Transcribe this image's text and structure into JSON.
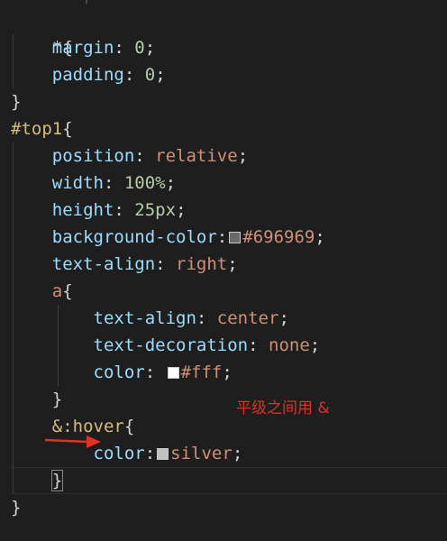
{
  "code": {
    "l1_sel": "*{",
    "l2_prop": "margin",
    "l2_val": "0",
    "l3_prop": "padding",
    "l3_val": "0",
    "l4_close": "}",
    "l5_sel": "#top1",
    "l5_brace": "{",
    "l6_prop": "position",
    "l6_val": "relative",
    "l7_prop": "width",
    "l7_val": "100%",
    "l8_prop": "height",
    "l8_val": "25px",
    "l9_prop": "background-color",
    "l9_val": "#696969",
    "l10_prop": "text-align",
    "l10_val": "right",
    "l11_sel": "a",
    "l11_brace": "{",
    "l12_prop": "text-align",
    "l12_val": "center",
    "l13_prop": "text-decoration",
    "l13_val": "none",
    "l14_prop": "color",
    "l14_val": "#fff",
    "l15_close": "}",
    "l16_sel": "&:hover",
    "l16_brace": "{",
    "l17_prop": "color",
    "l17_val": "silver",
    "l18_close": "}",
    "l19_close": "}"
  },
  "swatches": {
    "gray": "#696969",
    "white": "#ffffff",
    "silver": "#c0c0c0"
  },
  "annotation": {
    "text": "平级之间用 &",
    "color": "#e0302a"
  },
  "colors": {
    "background": "#1e1e1e",
    "property": "#9cdcfe",
    "number": "#b5cea8",
    "string_value": "#ce9178",
    "selector": "#d7ba7d",
    "punctuation": "#d4d4d4"
  }
}
